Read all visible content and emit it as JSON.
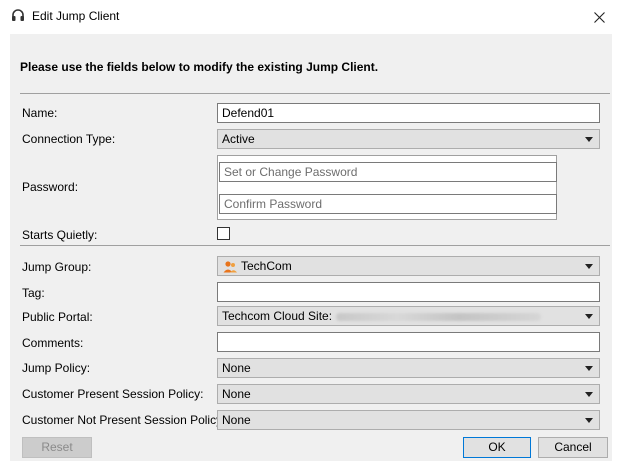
{
  "window": {
    "title": "Edit Jump Client",
    "close_icon": "close-icon",
    "app_icon": "headset-icon"
  },
  "intro": "Please use the fields below to modify the existing Jump Client.",
  "form": {
    "name": {
      "label": "Name:",
      "value": "Defend01"
    },
    "connection_type": {
      "label": "Connection Type:",
      "value": "Active"
    },
    "password": {
      "label": "Password:",
      "placeholder": "Set or Change Password",
      "confirm_placeholder": "Confirm Password"
    },
    "starts_quietly": {
      "label": "Starts Quietly:",
      "checked": false
    },
    "jump_group": {
      "label": "Jump Group:",
      "value": "TechCom",
      "icon": "group-icon"
    },
    "tag": {
      "label": "Tag:",
      "value": ""
    },
    "public_portal": {
      "label": "Public Portal:",
      "value": "Techcom Cloud Site:"
    },
    "comments": {
      "label": "Comments:",
      "value": ""
    },
    "jump_policy": {
      "label": "Jump Policy:",
      "value": "None"
    },
    "present_policy": {
      "label": "Customer Present Session Policy:",
      "value": "None"
    },
    "not_present_policy": {
      "label": "Customer Not Present Session Policy:",
      "value": "None"
    }
  },
  "buttons": {
    "reset": "Reset",
    "ok": "OK",
    "cancel": "Cancel"
  },
  "colors": {
    "dialog_bg": "#f0f0f0",
    "accent": "#0078d7",
    "group_icon": "#e8741c"
  }
}
